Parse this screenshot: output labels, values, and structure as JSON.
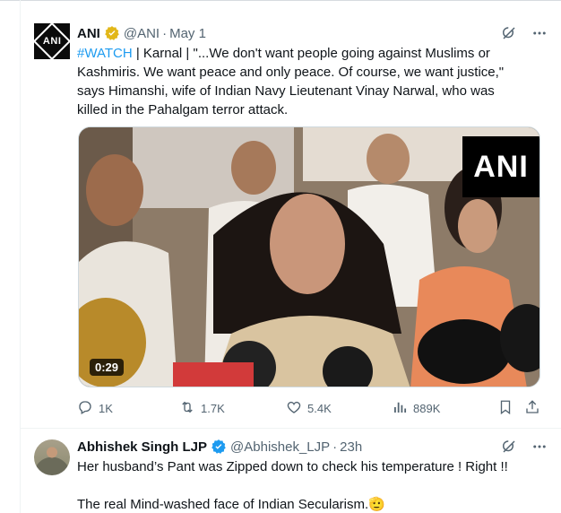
{
  "tweet1": {
    "author_name": "ANI",
    "avatar_text": "ANI",
    "handle": "@ANI",
    "separator": "·",
    "time": "May 1",
    "hashtag": "#WATCH",
    "lines": [
      " | Karnal | \"...We don't want people going against Muslims or",
      "Kashmiris. We want peace and only peace. Of course, we want justice,\"",
      "says Himanshi, wife of  Indian Navy Lieutenant Vinay Narwal, who was",
      "killed in the Pahalgam terror attack."
    ],
    "video": {
      "duration": "0:29",
      "watermark": "ANI"
    },
    "metrics": {
      "replies": "1K",
      "reposts": "1.7K",
      "likes": "5.4K",
      "views": "889K"
    }
  },
  "tweet2": {
    "author_name": "Abhishek Singh LJP",
    "handle": "@Abhishek_LJP",
    "separator": "·",
    "time": "23h",
    "lines": [
      "Her husband’s Pant was Zipped down to check his temperature ! Right !!",
      "The real Mind-washed face of Indian Secularism."
    ],
    "emoji": "🫡"
  },
  "colors": {
    "accent": "#1d9bf0",
    "verified_gold": "#e2b719",
    "verified_blue": "#1d9bf0",
    "muted": "#536471",
    "text": "#0f1419"
  },
  "icons": [
    "grok-icon",
    "more-icon",
    "reply-icon",
    "repost-icon",
    "like-icon",
    "views-icon",
    "bookmark-icon",
    "share-icon",
    "verified-badge-icon"
  ]
}
